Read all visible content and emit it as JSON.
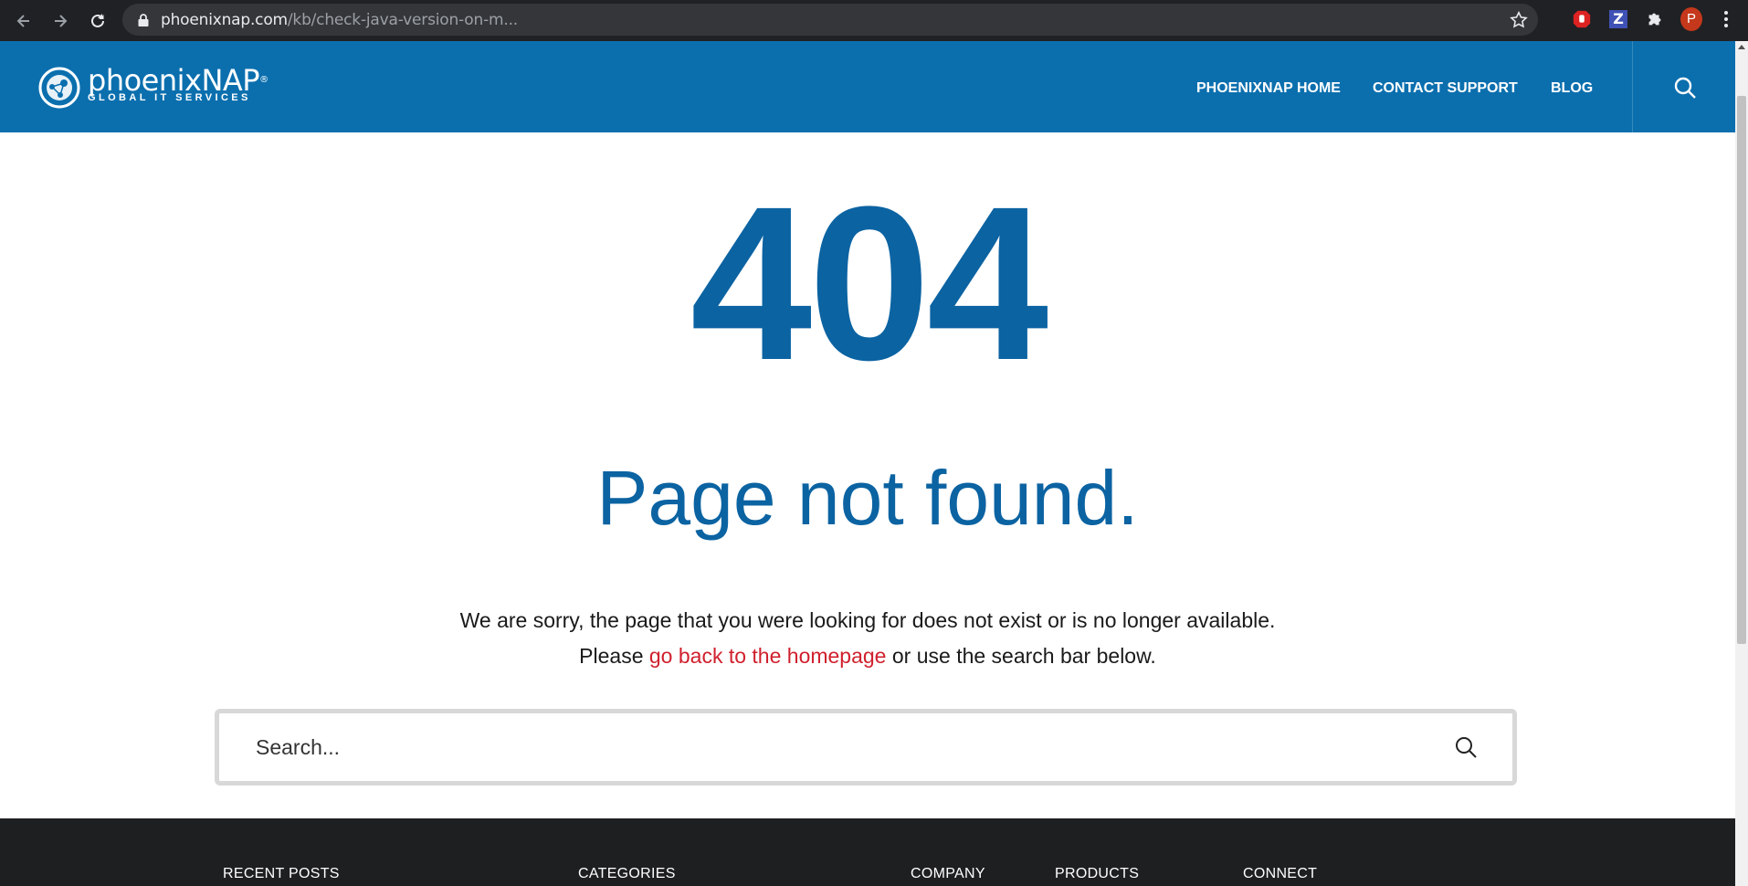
{
  "browser": {
    "url_host": "phoenixnap.com",
    "url_path": "/kb/check-java-version-on-m...",
    "profile_initial": "P",
    "extensions": [
      "stop-hand-icon",
      "z-extension-icon",
      "puzzle-icon"
    ]
  },
  "header": {
    "logo_name": "phoenixNAP",
    "logo_trademark": "®",
    "logo_tagline": "GLOBAL IT SERVICES",
    "menu": [
      {
        "label": "PHOENIXNAP HOME"
      },
      {
        "label": "CONTACT SUPPORT"
      },
      {
        "label": "BLOG"
      }
    ],
    "brand_color": "#0b6fae"
  },
  "main": {
    "code": "404",
    "title": "Page not found.",
    "message_line1": "We are sorry, the page that you were looking for does not exist or is no longer available.",
    "message_line2_before": "Please ",
    "message_link": "go back to the homepage",
    "message_line2_after": " or use the search bar below.",
    "link_color": "#d0202d",
    "search_placeholder": "Search..."
  },
  "footer": {
    "columns": [
      {
        "label": "RECENT POSTS"
      },
      {
        "label": "CATEGORIES"
      },
      {
        "label": "COMPANY"
      },
      {
        "label": "PRODUCTS"
      },
      {
        "label": "CONNECT"
      }
    ]
  }
}
